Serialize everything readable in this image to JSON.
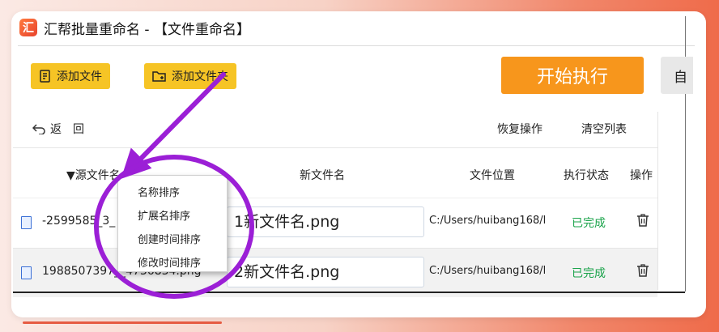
{
  "window": {
    "title": "汇帮批量重命名 - 【文件重命名】"
  },
  "toolbar": {
    "add_file": "添加文件",
    "add_folder": "添加文件夹",
    "start": "开始执行",
    "partial": "自"
  },
  "actions": {
    "back": "返回",
    "undo": "恢复操作",
    "clear": "清空列表"
  },
  "table": {
    "columns": {
      "source": "▼源文件名",
      "new_name": "新文件名",
      "location": "文件位置",
      "status": "执行状态",
      "operation": "操作"
    },
    "rows": [
      {
        "source": "-2599585_3_",
        "new_name": "1新文件名.png",
        "location": "C:/Users/huibang168/l",
        "status": "已完成"
      },
      {
        "source": "1988507397_",
        "new_name": "2新文件名.png",
        "location": "C:/Users/huibang168/l",
        "status": "已完成"
      }
    ],
    "row2_source_tail": "_4736834.png"
  },
  "sort_menu": {
    "items": [
      "名称排序",
      "扩展名排序",
      "创建时间排序",
      "修改时间排序"
    ]
  },
  "colors": {
    "accent": "#f7961c",
    "button": "#f6c425",
    "done": "#1aa34a",
    "annotation": "#9b1fd6"
  }
}
